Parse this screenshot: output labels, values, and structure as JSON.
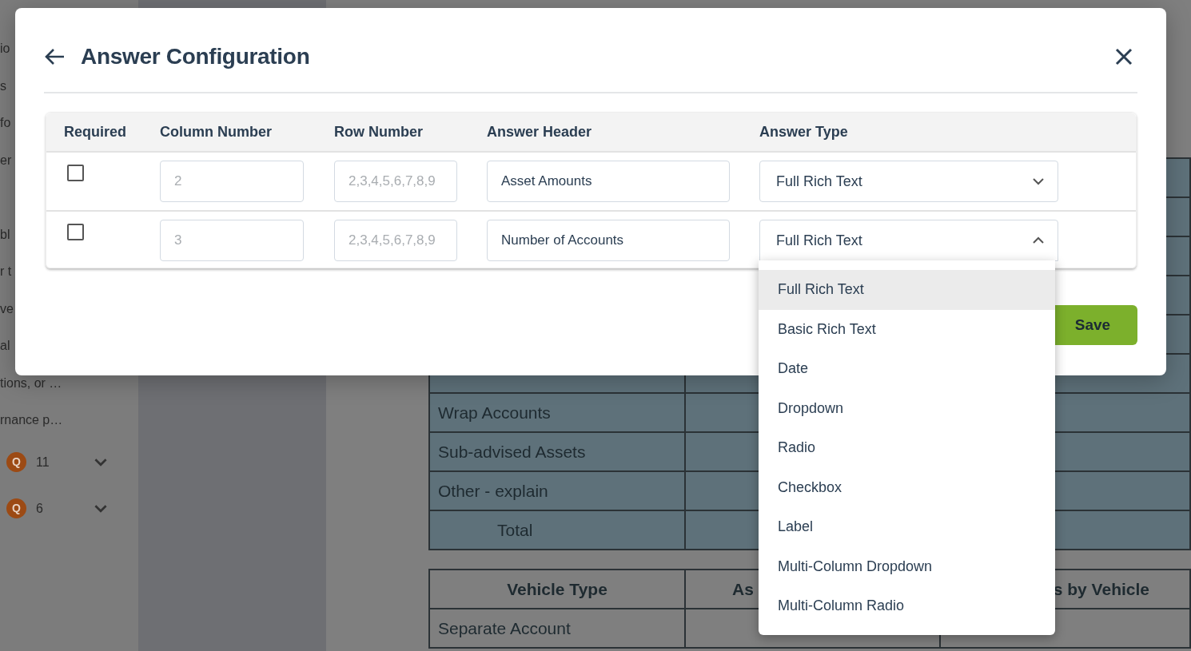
{
  "sidebar": {
    "fragments_top": [
      "io",
      "s",
      "fo",
      "er"
    ],
    "fragments_bottom": [
      "bl",
      "r t",
      "ve",
      "al",
      "tions, or …",
      "rnance p…"
    ],
    "question_items": [
      {
        "badge": "Q",
        "count": "11"
      },
      {
        "badge": "Q",
        "count": "6"
      }
    ]
  },
  "background_table": {
    "rows": [
      [
        "",
        ""
      ],
      [
        "",
        ""
      ],
      [
        "",
        ""
      ],
      [
        "",
        ""
      ],
      [
        "",
        ""
      ],
      [
        "",
        ""
      ],
      [
        "Wrap Accounts",
        ""
      ],
      [
        "Sub-advised Assets",
        ""
      ],
      [
        "Other - explain",
        ""
      ],
      [
        "Total",
        ""
      ]
    ]
  },
  "vehicle_table": {
    "columns": [
      "Vehicle Type",
      "As",
      "s by Vehicle"
    ],
    "rows": [
      [
        "Separate Account",
        "",
        ""
      ]
    ]
  },
  "dialog": {
    "title": "Answer Configuration",
    "columns": [
      "Required",
      "Column Number",
      "Row Number",
      "Answer Header",
      "Answer Type"
    ],
    "rows": [
      {
        "required": false,
        "column_number": "2",
        "row_number": "2,3,4,5,6,7,8,9",
        "answer_header": "Asset Amounts",
        "answer_type": "Full Rich Text",
        "expanded": false
      },
      {
        "required": false,
        "column_number": "3",
        "row_number": "2,3,4,5,6,7,8,9",
        "answer_header": "Number of Accounts",
        "answer_type": "Full Rich Text",
        "expanded": true
      }
    ],
    "save_label": "Save",
    "options": [
      {
        "label": "Full Rich Text",
        "selected": true
      },
      {
        "label": "Basic Rich Text",
        "selected": false
      },
      {
        "label": "Date",
        "selected": false
      },
      {
        "label": "Dropdown",
        "selected": false
      },
      {
        "label": "Radio",
        "selected": false
      },
      {
        "label": "Checkbox",
        "selected": false
      },
      {
        "label": "Label",
        "selected": false
      },
      {
        "label": "Multi-Column Dropdown",
        "selected": false
      },
      {
        "label": "Multi-Column Radio",
        "selected": false
      }
    ]
  }
}
